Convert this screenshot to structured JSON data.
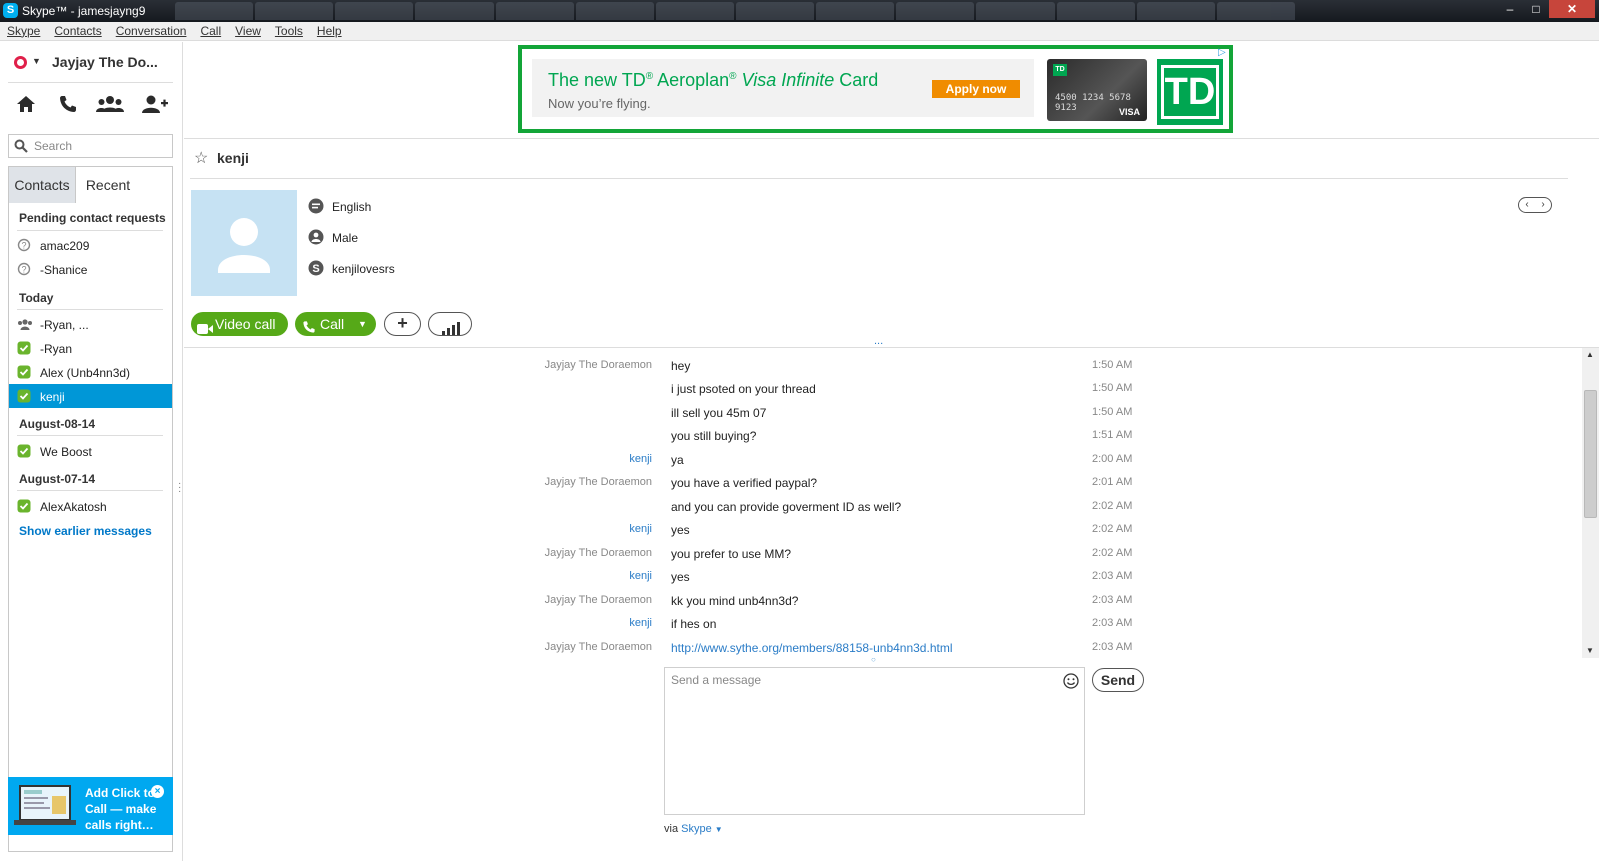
{
  "window": {
    "title": "Skype™ - jamesjayng9",
    "app_icon_letter": "S",
    "controls": {
      "minimize": "–",
      "maximize": "□",
      "close": "✕"
    }
  },
  "menu": [
    "Skype",
    "Contacts",
    "Conversation",
    "Call",
    "View",
    "Tools",
    "Help"
  ],
  "profile": {
    "name": "Jayjay The Do...",
    "status_color": "#e0204a"
  },
  "nav_icons": [
    "home-icon",
    "phone-icon",
    "group-icon",
    "add-contact-icon"
  ],
  "search": {
    "placeholder": "Search"
  },
  "contact_tabs": {
    "active": "Contacts",
    "other": "Recent"
  },
  "sections": {
    "pending": {
      "title": "Pending contact requests",
      "items": [
        {
          "label": "amac209"
        },
        {
          "label": "-Shanice"
        }
      ]
    },
    "today": {
      "title": "Today",
      "items": [
        {
          "label": "-Ryan, ...",
          "icon": "group-icon"
        },
        {
          "label": "-Ryan",
          "icon": "online-status-icon"
        },
        {
          "label": "Alex (Unb4nn3d)",
          "icon": "online-status-icon"
        },
        {
          "label": "kenji",
          "icon": "online-status-icon",
          "selected": true
        }
      ]
    },
    "aug08": {
      "title": "August-08-14",
      "items": [
        {
          "label": "We Boost"
        }
      ]
    },
    "aug07": {
      "title": "August-07-14",
      "items": [
        {
          "label": "AlexAkatosh"
        }
      ]
    },
    "show_earlier": "Show earlier messages"
  },
  "promo": {
    "text": "Add Click to Call — make calls right…",
    "close": "×"
  },
  "ad": {
    "headline_prefix": "The new TD",
    "headline_reg": "®",
    "headline_mid": " Aeroplan",
    "headline_reg2": "®",
    "headline_visa": " Visa Infinite",
    "headline_suffix": " Card",
    "subline": "Now you’re flying.",
    "cta": "Apply now",
    "card_number": "4500 1234 5678 9123",
    "card_brand": "VISA",
    "logo": "TD",
    "brand_color": "#00a651"
  },
  "conversation": {
    "contact": "kenji",
    "language": "English",
    "gender": "Male",
    "skype_name": "kenjilovesrs",
    "nav": {
      "prev": "‹",
      "next": "›"
    }
  },
  "actions": {
    "video_call": "Video call",
    "call": "Call",
    "add": "+",
    "call_quality": "call-quality-icon"
  },
  "more_indicator": "...",
  "messages": [
    {
      "sender": "Jayjay The Doraemon",
      "text": "hey",
      "time": "1:50 AM",
      "from": "me"
    },
    {
      "sender": "",
      "text": "i just psoted on your thread",
      "time": "1:50 AM",
      "from": "me"
    },
    {
      "sender": "",
      "text": "ill sell you 45m 07",
      "time": "1:50 AM",
      "from": "me"
    },
    {
      "sender": "",
      "text": "you still buying?",
      "time": "1:51 AM",
      "from": "me"
    },
    {
      "sender": "kenji",
      "text": "ya",
      "time": "2:00 AM",
      "from": "them"
    },
    {
      "sender": "Jayjay The Doraemon",
      "text": "you have a verified paypal?",
      "time": "2:01 AM",
      "from": "me"
    },
    {
      "sender": "",
      "text": "and you can provide goverment ID as well?",
      "time": "2:02 AM",
      "from": "me"
    },
    {
      "sender": "kenji",
      "text": "yes",
      "time": "2:02 AM",
      "from": "them"
    },
    {
      "sender": "Jayjay The Doraemon",
      "text": "you prefer to use MM?",
      "time": "2:02 AM",
      "from": "me"
    },
    {
      "sender": "kenji",
      "text": "yes",
      "time": "2:03 AM",
      "from": "them"
    },
    {
      "sender": "Jayjay The Doraemon",
      "text": "kk you mind unb4nn3d?",
      "time": "2:03 AM",
      "from": "me"
    },
    {
      "sender": "kenji",
      "text": "if hes on",
      "time": "2:03 AM",
      "from": "them"
    },
    {
      "sender": "Jayjay The Doraemon",
      "text": "http://www.sythe.org/members/88158-unb4nn3d.html",
      "time": "2:03 AM",
      "from": "me",
      "link": true
    }
  ],
  "compose": {
    "placeholder": "Send a message",
    "send": "Send",
    "via_prefix": "via",
    "via_service": "Skype"
  },
  "colors": {
    "accent": "#0097d7",
    "call_green": "#56a918",
    "link_blue": "#2a7cc7",
    "ad_border": "#13a538"
  }
}
